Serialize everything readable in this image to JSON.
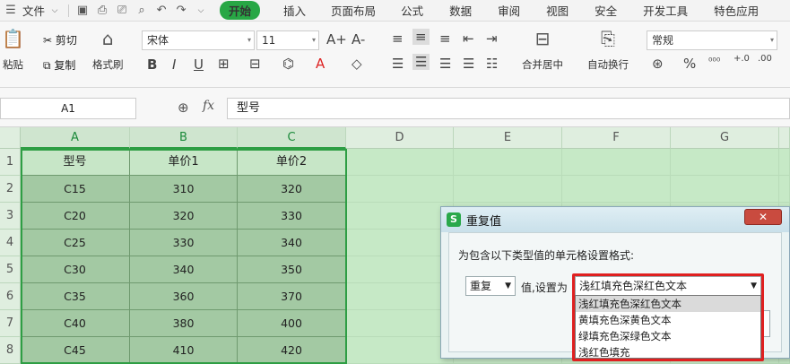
{
  "menubar": {
    "file": "文件",
    "tabs": [
      "开始",
      "插入",
      "页面布局",
      "公式",
      "数据",
      "审阅",
      "视图",
      "安全",
      "开发工具",
      "特色应用"
    ]
  },
  "ribbon": {
    "paste": "粘贴",
    "cut": "剪切",
    "copy": "复制",
    "format_painter": "格式刷",
    "font_name": "宋体",
    "font_size": "11",
    "merge_center": "合并居中",
    "wrap_text": "自动换行",
    "number_format": "常规",
    "bold": "B",
    "italic": "I",
    "underline": "U",
    "percent": "%",
    "grow_font": "A+",
    "shrink_font": "A-"
  },
  "formula_bar": {
    "name_box": "A1",
    "fx": "fx",
    "content": "型号"
  },
  "sheet": {
    "columns": [
      "A",
      "B",
      "C",
      "D",
      "E",
      "F",
      "G"
    ],
    "rows": [
      "1",
      "2",
      "3",
      "4",
      "5",
      "6",
      "7",
      "8"
    ],
    "data": [
      [
        "型号",
        "单价1",
        "单价2"
      ],
      [
        "C15",
        "310",
        "320"
      ],
      [
        "C20",
        "320",
        "330"
      ],
      [
        "C25",
        "330",
        "340"
      ],
      [
        "C30",
        "340",
        "350"
      ],
      [
        "C35",
        "360",
        "370"
      ],
      [
        "C40",
        "380",
        "400"
      ],
      [
        "C45",
        "410",
        "420"
      ]
    ]
  },
  "dialog": {
    "title": "重复值",
    "close": "✕",
    "prompt": "为包含以下类型值的单元格设置格式:",
    "type_value": "重复",
    "value_label": "值,设置为",
    "format_selected": "浅红填充色深红色文本",
    "options": [
      "浅红填充色深红色文本",
      "黄填充色深黄色文本",
      "绿填充色深绿色文本",
      "浅红色填充"
    ]
  },
  "colors": {
    "accent": "#28a745",
    "selection_fill": "#a3c9a3",
    "highlight_frame": "#e02020"
  }
}
